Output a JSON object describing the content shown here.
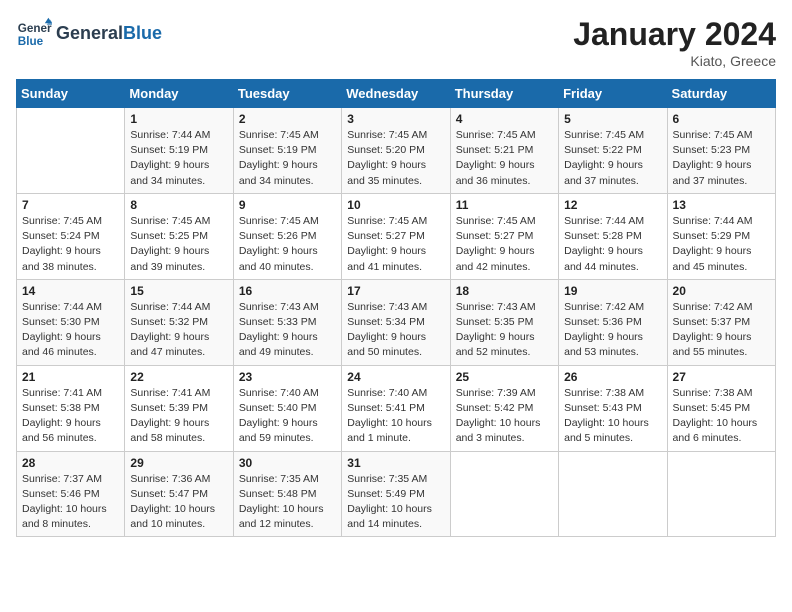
{
  "header": {
    "logo_line1": "General",
    "logo_line2": "Blue",
    "month": "January 2024",
    "location": "Kiato, Greece"
  },
  "days_of_week": [
    "Sunday",
    "Monday",
    "Tuesday",
    "Wednesday",
    "Thursday",
    "Friday",
    "Saturday"
  ],
  "weeks": [
    [
      {
        "day": "",
        "info": ""
      },
      {
        "day": "1",
        "info": "Sunrise: 7:44 AM\nSunset: 5:19 PM\nDaylight: 9 hours\nand 34 minutes."
      },
      {
        "day": "2",
        "info": "Sunrise: 7:45 AM\nSunset: 5:19 PM\nDaylight: 9 hours\nand 34 minutes."
      },
      {
        "day": "3",
        "info": "Sunrise: 7:45 AM\nSunset: 5:20 PM\nDaylight: 9 hours\nand 35 minutes."
      },
      {
        "day": "4",
        "info": "Sunrise: 7:45 AM\nSunset: 5:21 PM\nDaylight: 9 hours\nand 36 minutes."
      },
      {
        "day": "5",
        "info": "Sunrise: 7:45 AM\nSunset: 5:22 PM\nDaylight: 9 hours\nand 37 minutes."
      },
      {
        "day": "6",
        "info": "Sunrise: 7:45 AM\nSunset: 5:23 PM\nDaylight: 9 hours\nand 37 minutes."
      }
    ],
    [
      {
        "day": "7",
        "info": "Sunrise: 7:45 AM\nSunset: 5:24 PM\nDaylight: 9 hours\nand 38 minutes."
      },
      {
        "day": "8",
        "info": "Sunrise: 7:45 AM\nSunset: 5:25 PM\nDaylight: 9 hours\nand 39 minutes."
      },
      {
        "day": "9",
        "info": "Sunrise: 7:45 AM\nSunset: 5:26 PM\nDaylight: 9 hours\nand 40 minutes."
      },
      {
        "day": "10",
        "info": "Sunrise: 7:45 AM\nSunset: 5:27 PM\nDaylight: 9 hours\nand 41 minutes."
      },
      {
        "day": "11",
        "info": "Sunrise: 7:45 AM\nSunset: 5:27 PM\nDaylight: 9 hours\nand 42 minutes."
      },
      {
        "day": "12",
        "info": "Sunrise: 7:44 AM\nSunset: 5:28 PM\nDaylight: 9 hours\nand 44 minutes."
      },
      {
        "day": "13",
        "info": "Sunrise: 7:44 AM\nSunset: 5:29 PM\nDaylight: 9 hours\nand 45 minutes."
      }
    ],
    [
      {
        "day": "14",
        "info": "Sunrise: 7:44 AM\nSunset: 5:30 PM\nDaylight: 9 hours\nand 46 minutes."
      },
      {
        "day": "15",
        "info": "Sunrise: 7:44 AM\nSunset: 5:32 PM\nDaylight: 9 hours\nand 47 minutes."
      },
      {
        "day": "16",
        "info": "Sunrise: 7:43 AM\nSunset: 5:33 PM\nDaylight: 9 hours\nand 49 minutes."
      },
      {
        "day": "17",
        "info": "Sunrise: 7:43 AM\nSunset: 5:34 PM\nDaylight: 9 hours\nand 50 minutes."
      },
      {
        "day": "18",
        "info": "Sunrise: 7:43 AM\nSunset: 5:35 PM\nDaylight: 9 hours\nand 52 minutes."
      },
      {
        "day": "19",
        "info": "Sunrise: 7:42 AM\nSunset: 5:36 PM\nDaylight: 9 hours\nand 53 minutes."
      },
      {
        "day": "20",
        "info": "Sunrise: 7:42 AM\nSunset: 5:37 PM\nDaylight: 9 hours\nand 55 minutes."
      }
    ],
    [
      {
        "day": "21",
        "info": "Sunrise: 7:41 AM\nSunset: 5:38 PM\nDaylight: 9 hours\nand 56 minutes."
      },
      {
        "day": "22",
        "info": "Sunrise: 7:41 AM\nSunset: 5:39 PM\nDaylight: 9 hours\nand 58 minutes."
      },
      {
        "day": "23",
        "info": "Sunrise: 7:40 AM\nSunset: 5:40 PM\nDaylight: 9 hours\nand 59 minutes."
      },
      {
        "day": "24",
        "info": "Sunrise: 7:40 AM\nSunset: 5:41 PM\nDaylight: 10 hours\nand 1 minute."
      },
      {
        "day": "25",
        "info": "Sunrise: 7:39 AM\nSunset: 5:42 PM\nDaylight: 10 hours\nand 3 minutes."
      },
      {
        "day": "26",
        "info": "Sunrise: 7:38 AM\nSunset: 5:43 PM\nDaylight: 10 hours\nand 5 minutes."
      },
      {
        "day": "27",
        "info": "Sunrise: 7:38 AM\nSunset: 5:45 PM\nDaylight: 10 hours\nand 6 minutes."
      }
    ],
    [
      {
        "day": "28",
        "info": "Sunrise: 7:37 AM\nSunset: 5:46 PM\nDaylight: 10 hours\nand 8 minutes."
      },
      {
        "day": "29",
        "info": "Sunrise: 7:36 AM\nSunset: 5:47 PM\nDaylight: 10 hours\nand 10 minutes."
      },
      {
        "day": "30",
        "info": "Sunrise: 7:35 AM\nSunset: 5:48 PM\nDaylight: 10 hours\nand 12 minutes."
      },
      {
        "day": "31",
        "info": "Sunrise: 7:35 AM\nSunset: 5:49 PM\nDaylight: 10 hours\nand 14 minutes."
      },
      {
        "day": "",
        "info": ""
      },
      {
        "day": "",
        "info": ""
      },
      {
        "day": "",
        "info": ""
      }
    ]
  ]
}
